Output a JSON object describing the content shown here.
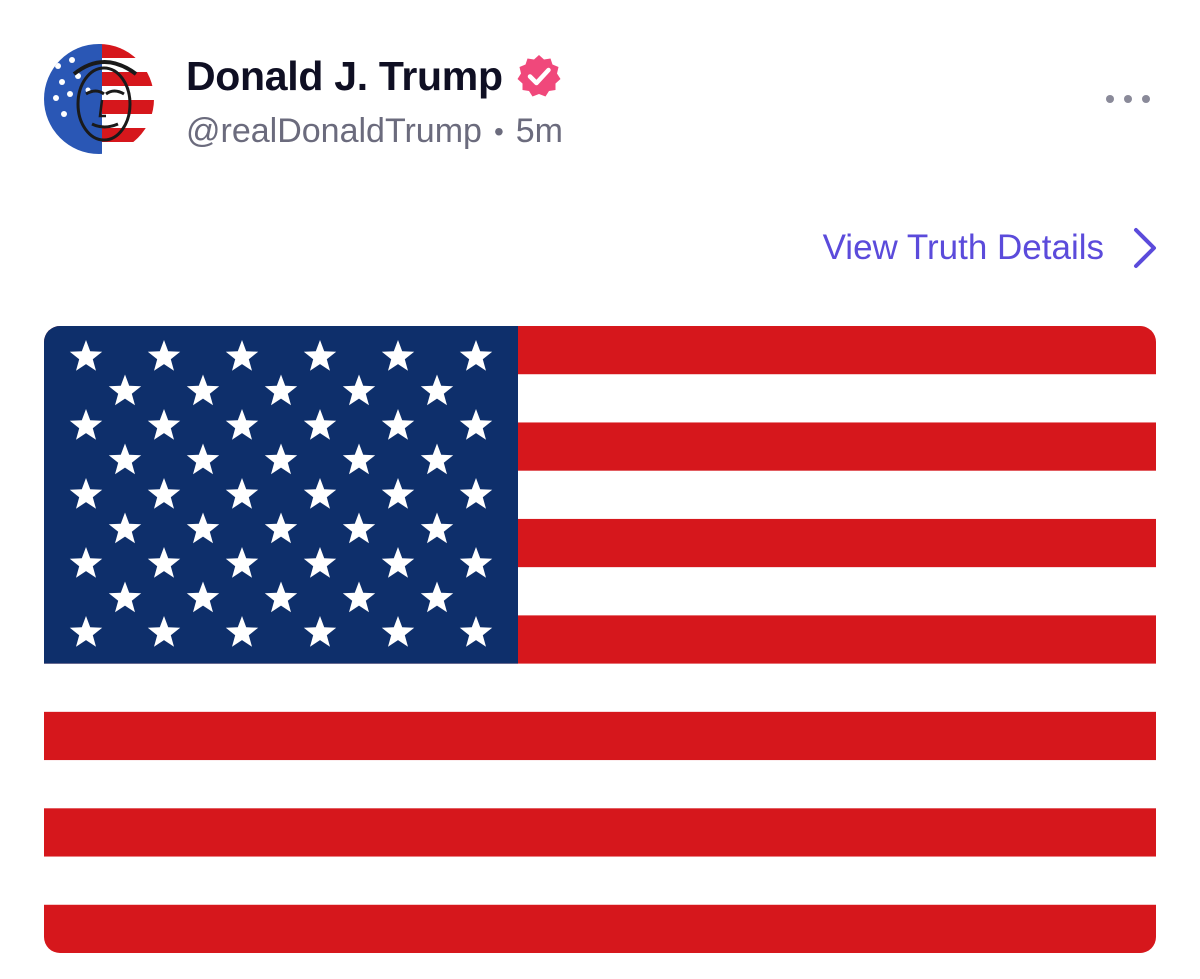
{
  "post": {
    "author": {
      "display_name": "Donald J. Trump",
      "handle": "@realDonaldTrump",
      "verified": true,
      "verified_badge_color": "#f0487b",
      "avatar_icon": "flag-portrait-avatar"
    },
    "separator": "•",
    "timestamp": "5m",
    "more_icon": "ellipsis-icon",
    "view_details_label": "View Truth Details",
    "view_details_icon": "chevron-right-icon",
    "link_color": "#5b4bdb",
    "media": {
      "kind": "image",
      "subject": "us-flag",
      "colors": {
        "red": "#d6171c",
        "white": "#ffffff",
        "blue": "#0e2f6b"
      }
    }
  }
}
